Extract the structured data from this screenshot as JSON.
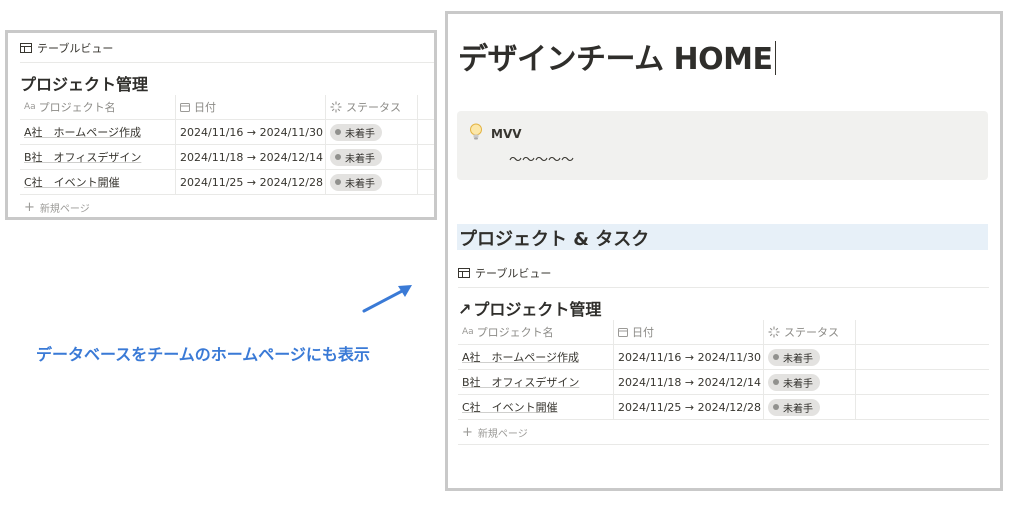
{
  "left": {
    "view_tab": "テーブルビュー",
    "db_title": "プロジェクト管理",
    "columns": {
      "name": "プロジェクト名",
      "date": "日付",
      "status": "ステータス",
      "name_icon": "Aa"
    },
    "rows": [
      {
        "name": "A社　ホームページ作成",
        "date": "2024/11/16 → 2024/11/30",
        "status": "未着手"
      },
      {
        "name": "B社　オフィスデザイン",
        "date": "2024/11/18 → 2024/12/14",
        "status": "未着手"
      },
      {
        "name": "C社　イベント開催",
        "date": "2024/11/25 → 2024/12/28",
        "status": "未着手"
      }
    ],
    "new_page": "新規ページ"
  },
  "annotation": "データベースをチームのホームページにも表示",
  "right": {
    "page_title": "デザインチーム HOME",
    "callout": {
      "title": "MVV",
      "body": "〜〜〜〜〜",
      "icon": "lightbulb-icon"
    },
    "section_heading": "プロジェクト & タスク",
    "view_tab": "テーブルビュー",
    "db_title": "プロジェクト管理",
    "db_title_arrow": "↗",
    "columns": {
      "name": "プロジェクト名",
      "date": "日付",
      "status": "ステータス",
      "name_icon": "Aa"
    },
    "rows": [
      {
        "name": "A社　ホームページ作成",
        "date": "2024/11/16 → 2024/11/30",
        "status": "未着手"
      },
      {
        "name": "B社　オフィスデザイン",
        "date": "2024/11/18 → 2024/12/14",
        "status": "未着手"
      },
      {
        "name": "C社　イベント開催",
        "date": "2024/11/25 → 2024/12/28",
        "status": "未着手"
      }
    ],
    "new_page": "新規ページ"
  },
  "colors": {
    "annotation": "#3a7ad6",
    "callout_bg": "#f1f1ef",
    "heading_bg": "#e7f0f8",
    "badge_bg": "#e3e2e0",
    "frame_border": "#c9c9c9"
  }
}
